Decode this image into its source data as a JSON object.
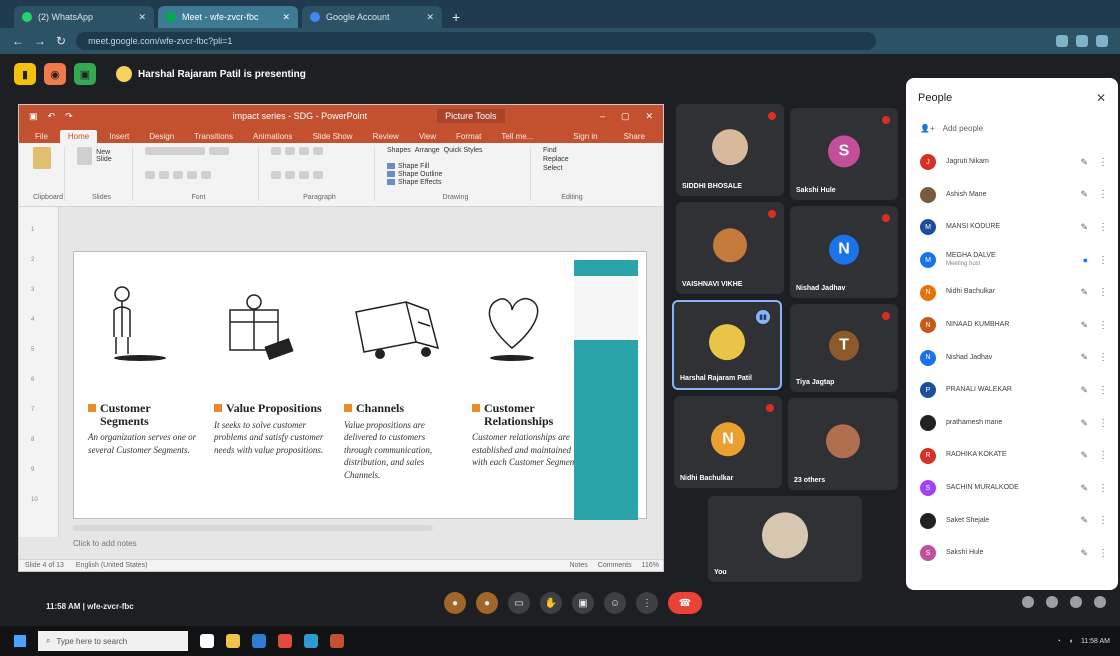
{
  "browser": {
    "tabs": [
      {
        "label": "(2) WhatsApp"
      },
      {
        "label": "Meet - wfe-zvcr-fbc"
      },
      {
        "label": "Google Account"
      }
    ],
    "url": "meet.google.com/wfe-zvcr-fbc?pli=1"
  },
  "meet": {
    "presenting_text": "Harshal Rajaram Patil is presenting",
    "bottom_info": "11:58 AM | wfe-zvcr-fbc"
  },
  "ppt": {
    "doc_title": "impact series - SDG - PowerPoint",
    "context_tab": "Picture Tools",
    "tabs": [
      "File",
      "Home",
      "Insert",
      "Design",
      "Transitions",
      "Animations",
      "Slide Show",
      "Review",
      "View",
      "Format"
    ],
    "tell_me": "Tell me...",
    "sign_in": "Sign in",
    "share": "Share",
    "ribbon": {
      "clipboard": "Clipboard",
      "slides": "Slides",
      "font": "Font",
      "paragraph": "Paragraph",
      "drawing": "Drawing",
      "editing": "Editing",
      "new_slide": "New Slide",
      "shapes": "Shapes",
      "arrange": "Arrange",
      "quick_styles": "Quick Styles",
      "shape_fill": "Shape Fill",
      "shape_outline": "Shape Outline",
      "shape_effects": "Shape Effects",
      "find": "Find",
      "replace": "Replace",
      "select": "Select"
    },
    "notes_placeholder": "Click to add notes",
    "status": {
      "slide": "Slide 4 of 13",
      "language": "English (United States)",
      "notes": "Notes",
      "comments": "Comments",
      "zoom": "116%"
    },
    "slide": {
      "columns": [
        {
          "title": "Customer Segments",
          "desc": "An organization serves one or several Customer Segments."
        },
        {
          "title": "Value Propositions",
          "desc": "It seeks to solve customer problems and satisfy customer needs with value propositions."
        },
        {
          "title": "Channels",
          "desc": "Value propositions are delivered to customers through communication, distribution, and sales Channels."
        },
        {
          "title": "Customer Relationships",
          "desc": "Customer relationships are established and maintained with each Customer Segment."
        }
      ]
    }
  },
  "tiles": [
    {
      "name": "SIDDHI BHOSALE",
      "initial": "",
      "color": "#d9b99b"
    },
    {
      "name": "Sakshi Hule",
      "initial": "S",
      "color": "#c14f9a"
    },
    {
      "name": "VAISHNAVI VIKHE",
      "initial": "",
      "color": "#c47a3a"
    },
    {
      "name": "Nishad Jadhav",
      "initial": "N",
      "color": "#1a73e8"
    },
    {
      "name": "Harshal Rajaram Patil",
      "initial": "",
      "color": "#e8c547"
    },
    {
      "name": "Tiya Jagtap",
      "initial": "T",
      "color": "#8d5a2b"
    },
    {
      "name": "Nidhi Bachulkar",
      "initial": "N",
      "color": "#e8a030"
    },
    {
      "name": "23 others",
      "initial": "",
      "color": "#b07050"
    },
    {
      "name": "You",
      "initial": "",
      "color": "#d6c8b0"
    }
  ],
  "people": {
    "title": "People",
    "add": "Add people",
    "list": [
      {
        "name": "Jagruti Nikam",
        "initial": "J",
        "color": "#d93025"
      },
      {
        "name": "Ashish Mane",
        "initial": "",
        "color": "#7a5a3a"
      },
      {
        "name": "MANSI KODURE",
        "initial": "M",
        "color": "#1a4f9c"
      },
      {
        "name": "MEGHA DALVE",
        "sub": "Meeting host",
        "initial": "M",
        "color": "#1a73e8"
      },
      {
        "name": "Nidhi Bachulkar",
        "initial": "N",
        "color": "#e8710a"
      },
      {
        "name": "NINAAD KUMBHAR",
        "initial": "N",
        "color": "#c5581c"
      },
      {
        "name": "Nishad Jadhav",
        "initial": "N",
        "color": "#1a73e8"
      },
      {
        "name": "PRANALI WALEKAR",
        "initial": "P",
        "color": "#1a4f9c"
      },
      {
        "name": "prathamesh mane",
        "initial": "",
        "color": "#202124"
      },
      {
        "name": "RADHIKA KOKATE",
        "initial": "R",
        "color": "#d93025"
      },
      {
        "name": "SACHIN MURALKODE",
        "initial": "S",
        "color": "#a142f4"
      },
      {
        "name": "Saket Shejale",
        "initial": "",
        "color": "#202124"
      },
      {
        "name": "Sakshi Hule",
        "initial": "S",
        "color": "#c14f9a"
      }
    ]
  },
  "taskbar": {
    "search_placeholder": "Type here to search",
    "clock": "11:58 AM"
  }
}
